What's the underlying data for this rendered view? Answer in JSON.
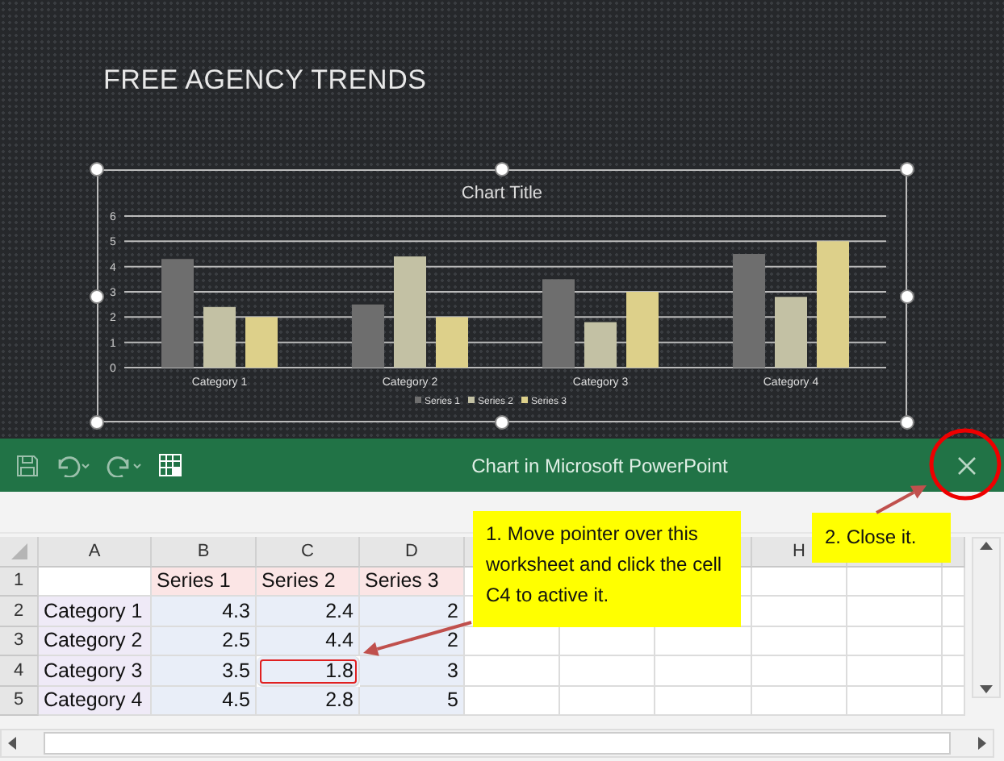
{
  "slide": {
    "title": "FREE AGENCY TRENDS",
    "chart": {
      "chart_data": {
        "type": "bar",
        "title": "Chart Title",
        "categories": [
          "Category 1",
          "Category 2",
          "Category 3",
          "Category 4"
        ],
        "series": [
          {
            "name": "Series 1",
            "color": "#6e6e6e",
            "values": [
              4.3,
              2.5,
              3.5,
              4.5
            ]
          },
          {
            "name": "Series 2",
            "color": "#c3c1a4",
            "values": [
              2.4,
              4.4,
              1.8,
              2.8
            ]
          },
          {
            "name": "Series 3",
            "color": "#ddd08a",
            "values": [
              2,
              2,
              3,
              5
            ]
          }
        ],
        "ylim": [
          0,
          6
        ],
        "yticks": [
          0,
          1,
          2,
          3,
          4,
          5,
          6
        ],
        "grid": true,
        "legend": true
      }
    }
  },
  "editor": {
    "title": "Chart in Microsoft PowerPoint",
    "columns": [
      "A",
      "B",
      "C",
      "D",
      "H"
    ],
    "rows": [
      {
        "number": "1",
        "cells": [
          {
            "color": "#ffffff"
          },
          {
            "text": "Series 1",
            "color": "#fbe5e5"
          },
          {
            "text": "Series 2",
            "color": "#fbe5e5"
          },
          {
            "text": "Series 3",
            "color": "#fbe5e5"
          }
        ]
      },
      {
        "number": "2",
        "cells": [
          {
            "text": "Category 1",
            "color": "#efeaf7"
          },
          {
            "text": "4.3",
            "color": "#e9eef8"
          },
          {
            "text": "2.4",
            "color": "#e9eef8"
          },
          {
            "text": "2",
            "color": "#e9eef8"
          }
        ]
      },
      {
        "number": "3",
        "cells": [
          {
            "text": "Category 2",
            "color": "#efeaf7"
          },
          {
            "text": "2.5",
            "color": "#e9eef8"
          },
          {
            "text": "4.4",
            "color": "#e9eef8"
          },
          {
            "text": "2",
            "color": "#e9eef8"
          }
        ]
      },
      {
        "number": "4",
        "cells": [
          {
            "text": "Category 3",
            "color": "#efeaf7"
          },
          {
            "text": "3.5",
            "color": "#e9eef8"
          },
          {
            "text": "1.8",
            "color": "#e9eef8",
            "circled": true
          },
          {
            "text": "3",
            "color": "#e9eef8"
          }
        ]
      },
      {
        "number": "5",
        "cells": [
          {
            "text": "Category 4",
            "color": "#efeaf7"
          },
          {
            "text": "4.5",
            "color": "#e9eef8"
          },
          {
            "text": "2.8",
            "color": "#e9eef8"
          },
          {
            "text": "5",
            "color": "#e9eef8"
          }
        ]
      }
    ]
  },
  "callouts": [
    "1. Move pointer over this worksheet and click the cell C4 to active it.",
    "2. Close it."
  ]
}
